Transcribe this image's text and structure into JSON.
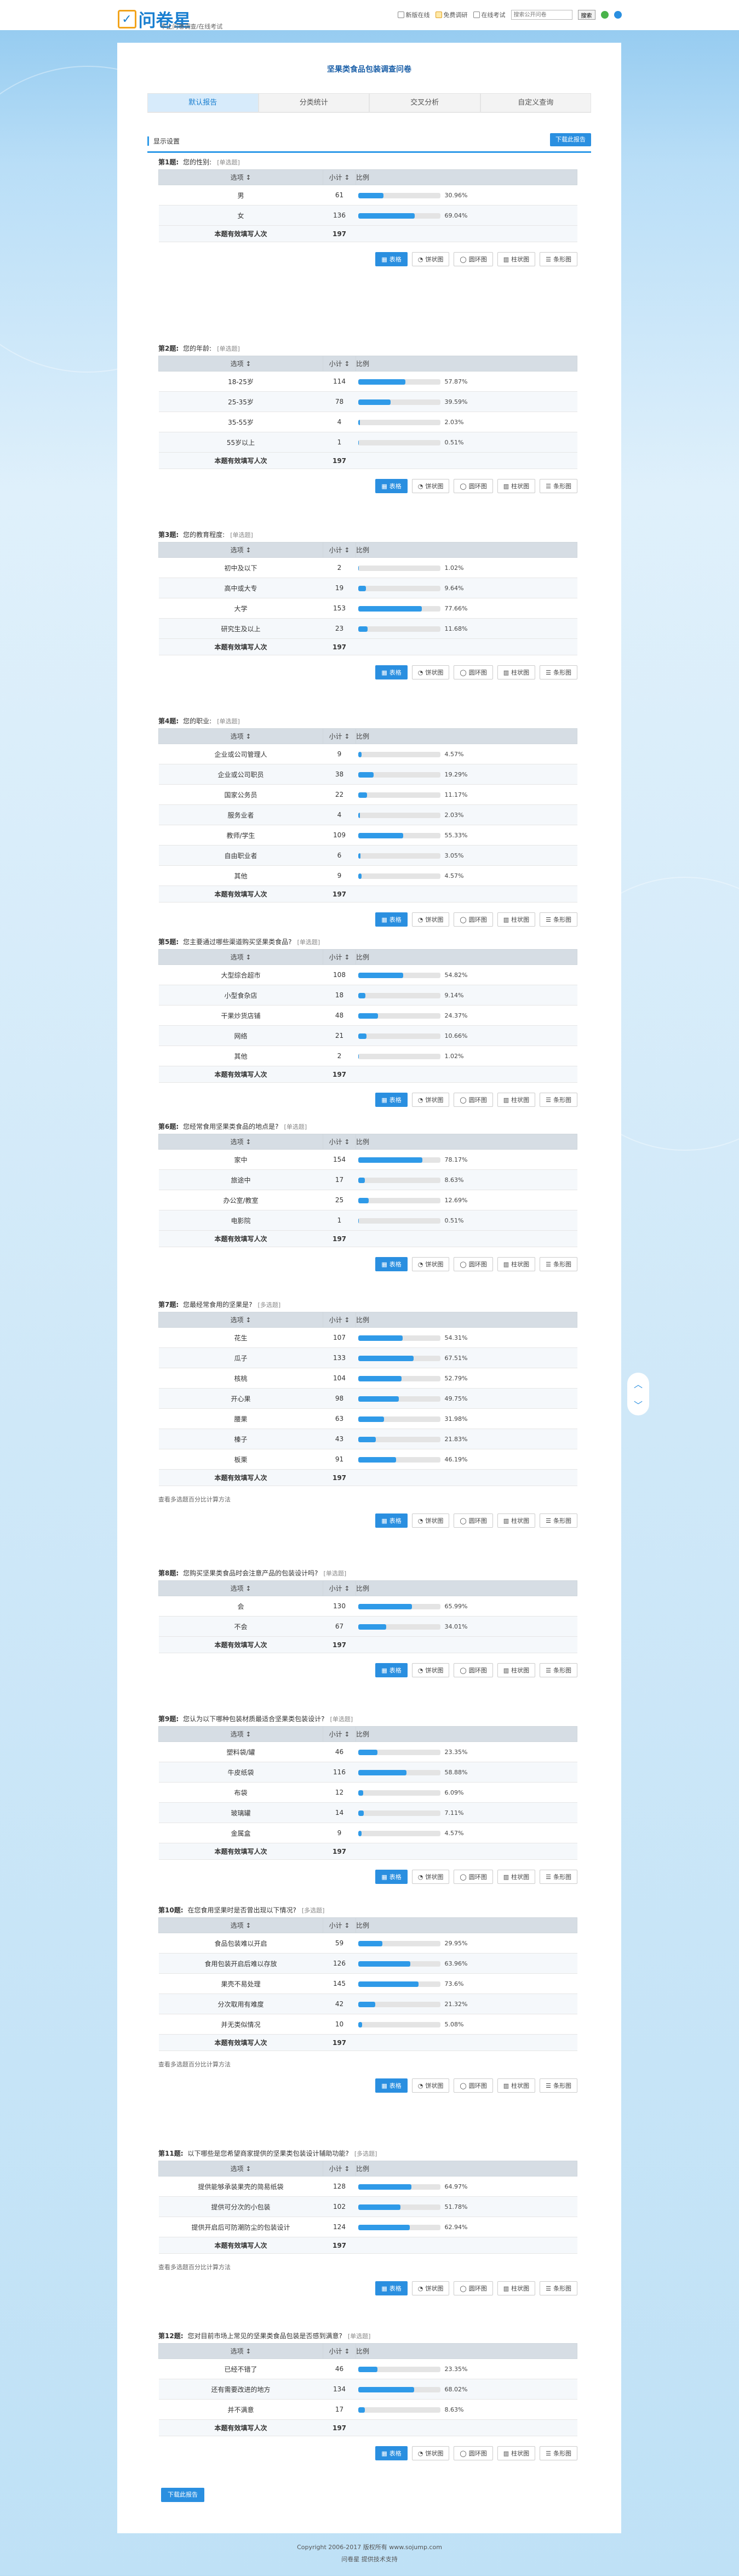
{
  "header": {
    "logo_text": "问卷星",
    "slogan": "不止问卷调查/在线考试",
    "links": [
      "新版在线",
      "免费调研",
      "在线考试"
    ],
    "search_placeholder": "搜索公开问卷",
    "search_btn": "搜索"
  },
  "page_title": "坚果类食品包装调查问卷",
  "tabs": [
    "默认报告",
    "分类统计",
    "交叉分析",
    "自定义查询"
  ],
  "setting_label": "显示设置",
  "download_label": "下载此报告",
  "col_option": "选项 ↕",
  "col_count": "小计 ↕",
  "col_ratio": "比例",
  "total_label": "本题有效填写人次",
  "buttons": [
    "表格",
    "饼状图",
    "圆环图",
    "柱状图",
    "条形图"
  ],
  "questions": [
    {
      "no": "第1题:",
      "title": "您的性别:",
      "type": "[单选题]",
      "total": "197",
      "rows": [
        [
          "男",
          "61",
          30.96,
          "30.96%"
        ],
        [
          "女",
          "136",
          69.04,
          "69.04%"
        ]
      ]
    },
    {
      "no": "第2题:",
      "title": "您的年龄:",
      "type": "[单选题]",
      "total": "197",
      "rows": [
        [
          "18-25岁",
          "114",
          57.87,
          "57.87%"
        ],
        [
          "25-35岁",
          "78",
          39.59,
          "39.59%"
        ],
        [
          "35-55岁",
          "4",
          2.03,
          "2.03%"
        ],
        [
          "55岁以上",
          "1",
          0.51,
          "0.51%"
        ]
      ]
    },
    {
      "no": "第3题:",
      "title": "您的教育程度:",
      "type": "[单选题]",
      "total": "197",
      "rows": [
        [
          "初中及以下",
          "2",
          1.02,
          "1.02%"
        ],
        [
          "高中或大专",
          "19",
          9.64,
          "9.64%"
        ],
        [
          "大学",
          "153",
          77.66,
          "77.66%"
        ],
        [
          "研究生及以上",
          "23",
          11.68,
          "11.68%"
        ]
      ]
    },
    {
      "no": "第4题:",
      "title": "您的职业:",
      "type": "[单选题]",
      "total": "197",
      "rows": [
        [
          "企业或公司管理人",
          "9",
          4.57,
          "4.57%"
        ],
        [
          "企业或公司职员",
          "38",
          19.29,
          "19.29%"
        ],
        [
          "国家公务员",
          "22",
          11.17,
          "11.17%"
        ],
        [
          "服务业者",
          "4",
          2.03,
          "2.03%"
        ],
        [
          "教师/学生",
          "109",
          55.33,
          "55.33%"
        ],
        [
          "自由职业者",
          "6",
          3.05,
          "3.05%"
        ],
        [
          "其他",
          "9",
          4.57,
          "4.57%"
        ]
      ]
    },
    {
      "no": "第5题:",
      "title": "您主要通过哪些渠道购买坚果类食品?",
      "type": "[单选题]",
      "total": "197",
      "rows": [
        [
          "大型综合超市",
          "108",
          54.82,
          "54.82%"
        ],
        [
          "小型食杂店",
          "18",
          9.14,
          "9.14%"
        ],
        [
          "干果炒货店铺",
          "48",
          24.37,
          "24.37%"
        ],
        [
          "网络",
          "21",
          10.66,
          "10.66%"
        ],
        [
          "其他",
          "2",
          1.02,
          "1.02%"
        ]
      ]
    },
    {
      "no": "第6题:",
      "title": "您经常食用坚果类食品的地点是?",
      "type": "[单选题]",
      "total": "197",
      "rows": [
        [
          "家中",
          "154",
          78.17,
          "78.17%"
        ],
        [
          "旅途中",
          "17",
          8.63,
          "8.63%"
        ],
        [
          "办公室/教室",
          "25",
          12.69,
          "12.69%"
        ],
        [
          "电影院",
          "1",
          0.51,
          "0.51%"
        ]
      ]
    },
    {
      "no": "第7题:",
      "title": "您最经常食用的坚果是?",
      "type": "[多选题]",
      "total": "197",
      "note": "查看多选题百分比计算方法",
      "rows": [
        [
          "花生",
          "107",
          54.31,
          "54.31%"
        ],
        [
          "瓜子",
          "133",
          67.51,
          "67.51%"
        ],
        [
          "核桃",
          "104",
          52.79,
          "52.79%"
        ],
        [
          "开心果",
          "98",
          49.75,
          "49.75%"
        ],
        [
          "腰果",
          "63",
          31.98,
          "31.98%"
        ],
        [
          "榛子",
          "43",
          21.83,
          "21.83%"
        ],
        [
          "板栗",
          "91",
          46.19,
          "46.19%"
        ]
      ]
    },
    {
      "no": "第8题:",
      "title": "您购买坚果类食品时会注意产品的包装设计吗?",
      "type": "[单选题]",
      "total": "197",
      "rows": [
        [
          "会",
          "130",
          65.99,
          "65.99%"
        ],
        [
          "不会",
          "67",
          34.01,
          "34.01%"
        ]
      ]
    },
    {
      "no": "第9题:",
      "title": "您认为以下哪种包装材质最适合坚果类包装设计?",
      "type": "[单选题]",
      "total": "197",
      "rows": [
        [
          "塑料袋/罐",
          "46",
          23.35,
          "23.35%"
        ],
        [
          "牛皮纸袋",
          "116",
          58.88,
          "58.88%"
        ],
        [
          "布袋",
          "12",
          6.09,
          "6.09%"
        ],
        [
          "玻璃罐",
          "14",
          7.11,
          "7.11%"
        ],
        [
          "金属盒",
          "9",
          4.57,
          "4.57%"
        ]
      ]
    },
    {
      "no": "第10题:",
      "title": "在您食用坚果时是否曾出现以下情况?",
      "type": "[多选题]",
      "total": "197",
      "note": "查看多选题百分比计算方法",
      "rows": [
        [
          "食品包装难以开启",
          "59",
          29.95,
          "29.95%"
        ],
        [
          "食用包装开启后难以存放",
          "126",
          63.96,
          "63.96%"
        ],
        [
          "果壳不易处理",
          "145",
          73.6,
          "73.6%"
        ],
        [
          "分次取用有难度",
          "42",
          21.32,
          "21.32%"
        ],
        [
          "并无类似情况",
          "10",
          5.08,
          "5.08%"
        ]
      ]
    },
    {
      "no": "第11题:",
      "title": "以下哪些是您希望商家提供的坚果类包装设计辅助功能?",
      "type": "[多选题]",
      "total": "197",
      "note": "查看多选题百分比计算方法",
      "rows": [
        [
          "提供能够承装果壳的简易纸袋",
          "128",
          64.97,
          "64.97%"
        ],
        [
          "提供可分次的小包装",
          "102",
          51.78,
          "51.78%"
        ],
        [
          "提供开启后可防潮防尘的包装设计",
          "124",
          62.94,
          "62.94%"
        ]
      ]
    },
    {
      "no": "第12题:",
      "title": "您对目前市场上常见的坚果类食品包装是否感到满意?",
      "type": "[单选题]",
      "total": "197",
      "rows": [
        [
          "已经不错了",
          "46",
          23.35,
          "23.35%"
        ],
        [
          "还有需要改进的地方",
          "134",
          68.02,
          "68.02%"
        ],
        [
          "并不满意",
          "17",
          8.63,
          "8.63%"
        ]
      ]
    }
  ],
  "footer": {
    "line1": "Copyright 2006-2017 版权所有 www.sojump.com",
    "line2": "问卷星 提供技术支持"
  }
}
